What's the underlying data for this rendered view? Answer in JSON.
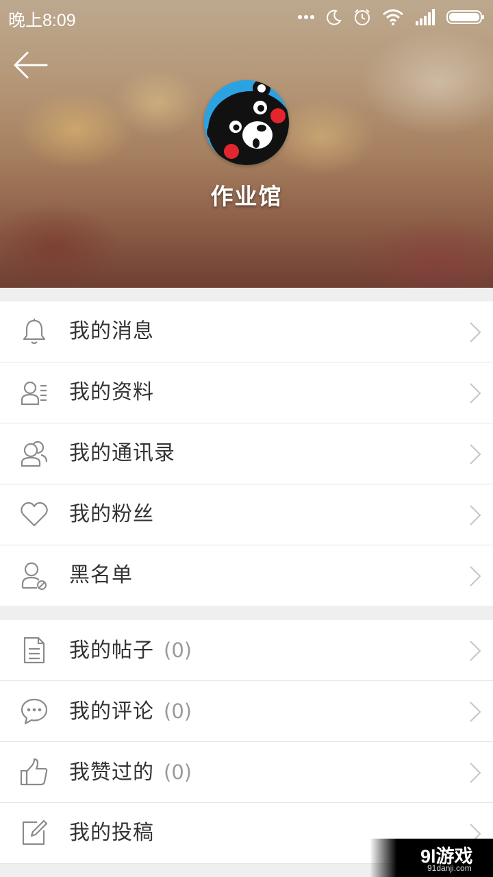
{
  "status_bar": {
    "time": "晚上8:09",
    "icons": [
      "more-dots-icon",
      "moon-icon",
      "alarm-icon",
      "wifi-icon",
      "signal-icon",
      "battery-icon"
    ]
  },
  "profile": {
    "username": "作业馆",
    "avatar": "kumamon-bear-avatar"
  },
  "menu_group_1": [
    {
      "label": "我的消息",
      "icon": "bell-icon"
    },
    {
      "label": "我的资料",
      "icon": "profile-card-icon"
    },
    {
      "label": "我的通讯录",
      "icon": "contacts-icon"
    },
    {
      "label": "我的粉丝",
      "icon": "heart-icon"
    },
    {
      "label": "黑名单",
      "icon": "blocked-user-icon"
    }
  ],
  "menu_group_2": [
    {
      "label": "我的帖子",
      "count": "(0)",
      "icon": "document-icon"
    },
    {
      "label": "我的评论",
      "count": "(0)",
      "icon": "comment-icon"
    },
    {
      "label": "我赞过的",
      "count": "(0)",
      "icon": "thumbs-up-icon"
    },
    {
      "label": "我的投稿",
      "icon": "edit-icon"
    }
  ],
  "watermark": {
    "brand": "9l游戏",
    "url": "91danji.com"
  },
  "colors": {
    "icon_gray": "#8a8a8a",
    "chevron": "#c8c8c8",
    "text": "#333333",
    "count": "#9a9a9a"
  }
}
